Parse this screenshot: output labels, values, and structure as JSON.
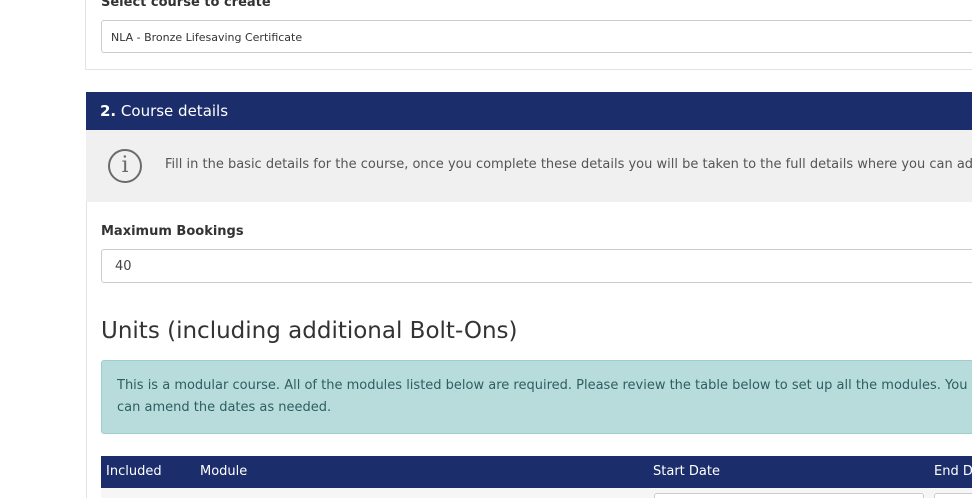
{
  "section1": {
    "select_label": "Select course to create",
    "selected_course": "NLA - Bronze Lifesaving Certificate"
  },
  "section2": {
    "number": "2.",
    "title": "Course details",
    "info_text": "Fill in the basic details for the course, once you complete these details you will be taken to the full details where you can add more",
    "max_bookings_label": "Maximum Bookings",
    "max_bookings_value": "40"
  },
  "units": {
    "title": "Units (including additional Bolt-Ons)",
    "alert_text": "This is a modular course. All of the modules listed below are required. Please review the table below to set up all the modules. You can amend the dates as needed.",
    "columns": [
      "Included",
      "Module",
      "Start Date",
      "End Date"
    ]
  },
  "colors": {
    "header_bg": "#1b2e6b",
    "alert_bg": "#b8dcdb",
    "info_bg": "#f0f0f0"
  }
}
